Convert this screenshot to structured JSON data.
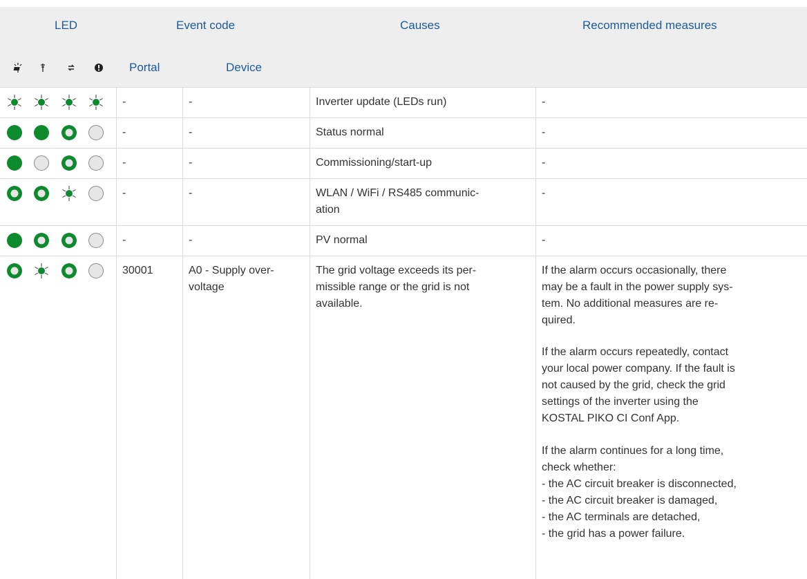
{
  "header": {
    "led": "LED",
    "event_code": "Event code",
    "causes": "Causes",
    "recommended_measures": "Recommended measures",
    "portal": "Portal",
    "device": "Device",
    "led_icons": [
      "solar-panel-icon",
      "power-pylon-icon",
      "communication-icon",
      "warning-icon"
    ]
  },
  "colors": {
    "header_text": "#1d5a9b",
    "header_bg": "#eeeeee",
    "led_green": "#0e8a2e",
    "led_off": "#e6e6e6"
  },
  "rows": [
    {
      "leds": [
        "blink",
        "blink",
        "blink",
        "blink"
      ],
      "portal": "-",
      "device": "-",
      "cause": "Inverter update (LEDs run)",
      "measures": [
        "-"
      ]
    },
    {
      "leds": [
        "on",
        "on",
        "ring",
        "off"
      ],
      "portal": "-",
      "device": "-",
      "cause": "Status normal",
      "measures": [
        "-"
      ]
    },
    {
      "leds": [
        "on",
        "off",
        "ring",
        "off"
      ],
      "portal": "-",
      "device": "-",
      "cause": "Commissioning/start-up",
      "measures": [
        "-"
      ]
    },
    {
      "leds": [
        "ring",
        "ring",
        "blink",
        "off"
      ],
      "portal": "-",
      "device": "-",
      "cause": "WLAN / WiFi / RS485 communic-\nation",
      "measures": [
        "-"
      ]
    },
    {
      "leds": [
        "on",
        "ring",
        "ring",
        "off"
      ],
      "portal": "-",
      "device": "-",
      "cause": "PV normal",
      "measures": [
        "-"
      ]
    },
    {
      "leds": [
        "ring",
        "blink",
        "ring",
        "off"
      ],
      "portal": "30001",
      "device": "A0 - Supply over-\nvoltage",
      "cause": "The grid voltage exceeds its per-\nmissible range or the grid is not\navailable.",
      "measures": [
        "If the alarm occurs occasionally, there\nmay be a fault in the power supply sys-\ntem. No additional measures are re-\nquired.",
        "If the alarm occurs repeatedly, contact\nyour local power company. If the fault is\nnot caused by the grid, check the grid\nsettings of the inverter using the\nKOSTAL PIKO CI Conf App.",
        "If the alarm continues for a long time,\ncheck whether:\n- the AC circuit breaker is disconnected,\n- the AC circuit breaker is damaged,\n- the AC terminals are detached,\n- the grid has a power failure."
      ]
    }
  ]
}
